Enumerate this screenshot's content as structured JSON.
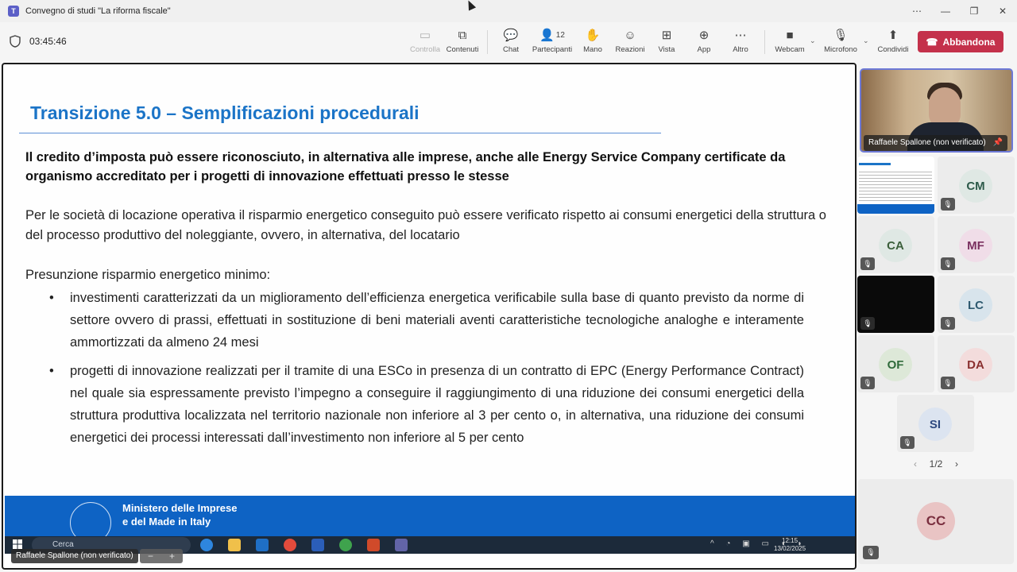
{
  "window": {
    "title": "Convegno di studi \"La riforma fiscale\"",
    "controls": {
      "more": "⋯",
      "minimize": "—",
      "restore": "❐",
      "close": "✕"
    }
  },
  "toolbar": {
    "timer": "03:45:46",
    "controlla": "Controlla",
    "contenuti": "Contenuti",
    "chat": "Chat",
    "participants_count": "12",
    "participants": "Partecipanti",
    "hand": "Mano",
    "reactions": "Reazioni",
    "view": "Vista",
    "app": "App",
    "more": "Altro",
    "webcam": "Webcam",
    "microphone": "Microfono",
    "share": "Condividi",
    "leave": "Abbandona"
  },
  "slide": {
    "title": "Transizione 5.0 – Semplificazioni procedurali",
    "bold_paragraph": "Il credito d’imposta può essere riconosciuto, in alternativa alle imprese, anche alle Energy Service Company certificate da organismo accreditato per i progetti di innovazione effettuati presso le stesse",
    "paragraph": "Per le società di locazione operativa il risparmio energetico conseguito può essere verificato rispetto ai consumi energetici della struttura o del processo produttivo del noleggiante, ovvero, in alternativa, del locatario",
    "list_heading": "Presunzione risparmio energetico minimo:",
    "bullets": [
      "investimenti caratterizzati da un miglioramento dell’efficienza energetica verificabile sulla base di quanto previsto da norme di settore ovvero di prassi, effettuati in sostituzione di beni materiali aventi caratteristiche tecnologiche analoghe e interamente ammortizzati da almeno 24 mesi",
      "progetti di innovazione realizzati per il tramite di una ESCo in presenza di un contratto di EPC (Energy Performance Contract) nel quale sia espressamente previsto l’impegno a conseguire il raggiungimento di una riduzione dei consumi energetici della struttura produttiva localizzata nel territorio nazionale non inferiore al 3 per cento o, in alternativa, una riduzione dei consumi energetici dei processi interessati dall’investimento non inferiore al 5 per cento"
    ],
    "ministry_line1": "Ministero delle Imprese",
    "ministry_line2": "e del Made in Italy"
  },
  "remote_taskbar": {
    "search": "Cerca",
    "time": "12:15",
    "date": "13/02/2025"
  },
  "presenter_tag": "Raffaele Spallone (non verificato)",
  "zoom": {
    "minus": "−",
    "plus": "+"
  },
  "pinned": {
    "name": "Raffaele Spallone (non verificato)",
    "pin_icon": "pin-icon"
  },
  "participants": [
    {
      "initials": "CM",
      "bg": "#dfe8e4",
      "fg": "#2d5a4a"
    },
    {
      "initials": "CA",
      "bg": "#dfe8e4",
      "fg": "#3b5f3b"
    },
    {
      "initials": "MF",
      "bg": "#f0dde8",
      "fg": "#7a2f5f"
    },
    {
      "initials": "LC",
      "bg": "#d8e4ec",
      "fg": "#2f5a70"
    },
    {
      "initials": "OF",
      "bg": "#dde8d8",
      "fg": "#2f6a3a"
    },
    {
      "initials": "DA",
      "bg": "#f3dcdc",
      "fg": "#8a2f2f"
    },
    {
      "initials": "SI",
      "bg": "#dce4f0",
      "fg": "#2f4a80"
    }
  ],
  "pager": {
    "prev": "‹",
    "label": "1/2",
    "next": "›"
  },
  "bottom_participant": {
    "initials": "CC"
  }
}
